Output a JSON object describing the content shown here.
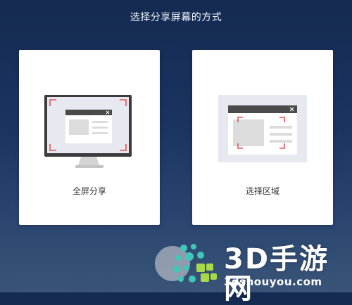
{
  "dialog": {
    "title": "选择分享屏幕的方式",
    "options": [
      {
        "label": "全屏分享",
        "icon": "full-screen-monitor-icon"
      },
      {
        "label": "选择区域",
        "icon": "select-region-icon"
      }
    ]
  },
  "colors": {
    "background_top": "#142a52",
    "background_bottom": "#3a5478",
    "card": "#ffffff",
    "corner_marker": "#e0565b",
    "window_bar": "#4a4a4a"
  },
  "watermark": {
    "brand": "3D手游网",
    "url": "3dshouyou.com"
  }
}
